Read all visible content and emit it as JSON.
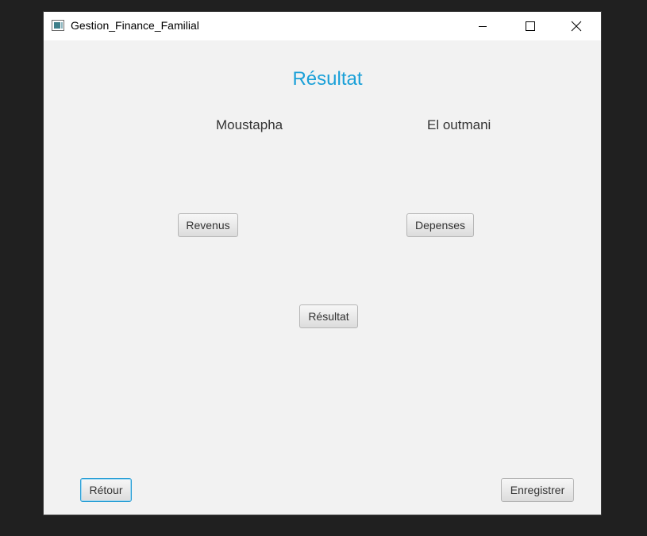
{
  "window": {
    "title": "Gestion_Finance_Familial",
    "icon": "app-window-icon",
    "controls": [
      "minimize-icon",
      "maximize-icon",
      "close-icon"
    ]
  },
  "main": {
    "heading": "Résultat",
    "first_name": "Moustapha",
    "last_name": "El outmani",
    "buttons": {
      "revenus": "Revenus",
      "depenses": "Depenses",
      "resultat": "Résultat"
    }
  },
  "footer": {
    "retour": "Rétour",
    "enregistrer": "Enregistrer"
  },
  "colors": {
    "heading": "#1aa0d8",
    "focus_border": "#2a9fd6",
    "background": "#f2f2f2",
    "desktop": "#202020"
  }
}
